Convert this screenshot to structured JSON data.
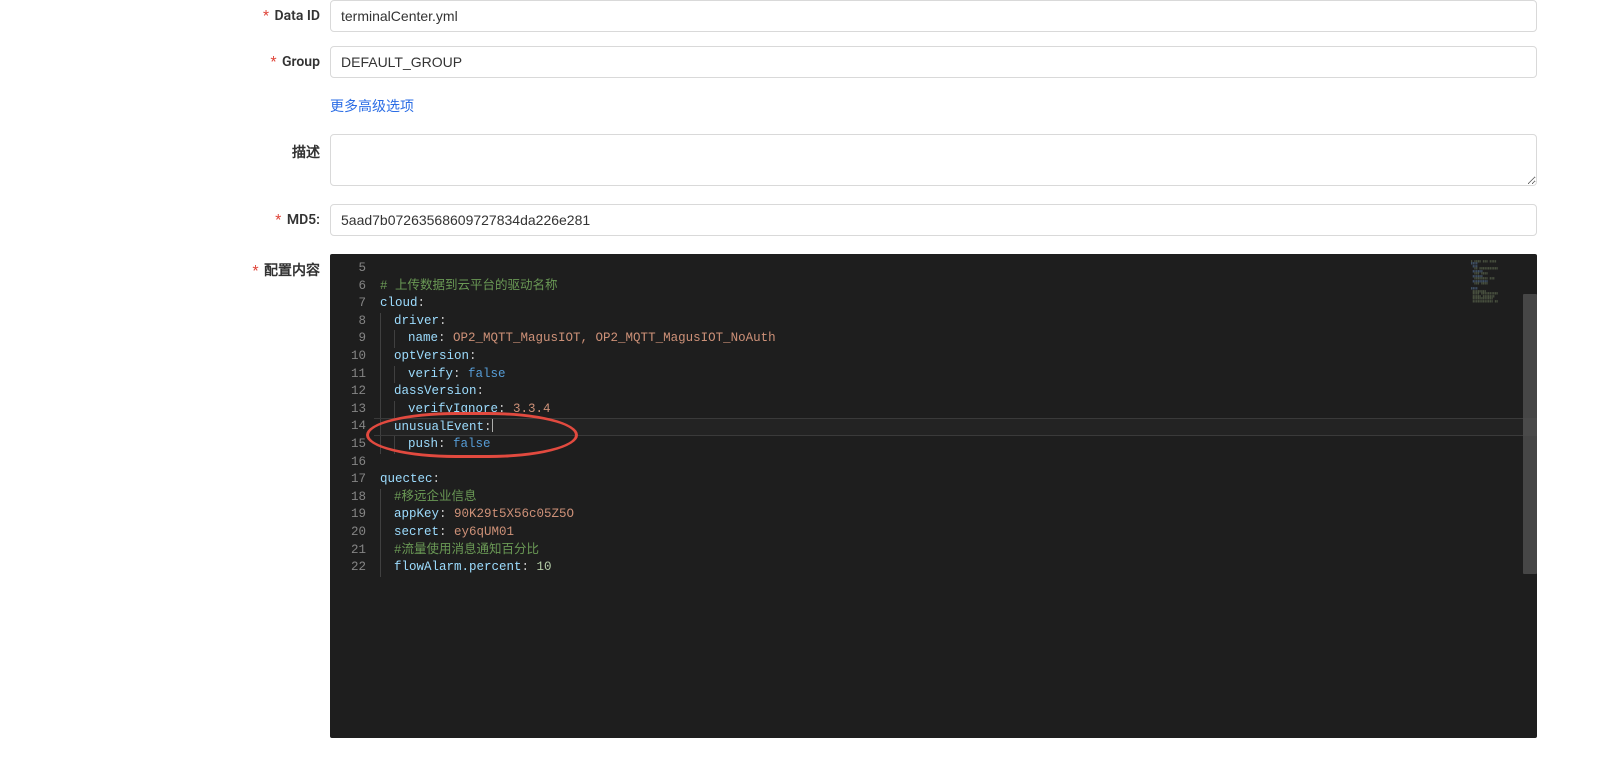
{
  "form": {
    "dataId": {
      "label": "Data ID",
      "value": "terminalCenter.yml"
    },
    "group": {
      "label": "Group",
      "value": "DEFAULT_GROUP"
    },
    "advancedLink": "更多高级选项",
    "description": {
      "label": "描述",
      "value": ""
    },
    "md5": {
      "label": "MD5:",
      "value": "5aad7b07263568609727834da226e281"
    },
    "configContent": {
      "label": "配置内容"
    }
  },
  "editor": {
    "startLine": 5,
    "activeLine": 14,
    "lines": [
      {
        "n": 5,
        "indent": 0,
        "segs": []
      },
      {
        "n": 6,
        "indent": 0,
        "segs": [
          {
            "t": "comment",
            "v": "# 上传数据到云平台的驱动名称"
          }
        ]
      },
      {
        "n": 7,
        "indent": 0,
        "segs": [
          {
            "t": "key",
            "v": "cloud"
          },
          {
            "t": "colon",
            "v": ":"
          }
        ]
      },
      {
        "n": 8,
        "indent": 1,
        "segs": [
          {
            "t": "key",
            "v": "driver"
          },
          {
            "t": "colon",
            "v": ":"
          }
        ]
      },
      {
        "n": 9,
        "indent": 2,
        "segs": [
          {
            "t": "key",
            "v": "name"
          },
          {
            "t": "colon",
            "v": ": "
          },
          {
            "t": "string",
            "v": "OP2_MQTT_MagusIOT, OP2_MQTT_MagusIOT_NoAuth"
          }
        ]
      },
      {
        "n": 10,
        "indent": 1,
        "segs": [
          {
            "t": "key",
            "v": "optVersion"
          },
          {
            "t": "colon",
            "v": ":"
          }
        ]
      },
      {
        "n": 11,
        "indent": 2,
        "segs": [
          {
            "t": "key",
            "v": "verify"
          },
          {
            "t": "colon",
            "v": ": "
          },
          {
            "t": "bool",
            "v": "false"
          }
        ]
      },
      {
        "n": 12,
        "indent": 1,
        "segs": [
          {
            "t": "key",
            "v": "dassVersion"
          },
          {
            "t": "colon",
            "v": ":"
          }
        ]
      },
      {
        "n": 13,
        "indent": 2,
        "segs": [
          {
            "t": "key",
            "v": "verifyIgnore"
          },
          {
            "t": "colon",
            "v": ": "
          },
          {
            "t": "string",
            "v": "3.3.4"
          }
        ]
      },
      {
        "n": 14,
        "indent": 1,
        "segs": [
          {
            "t": "key",
            "v": "unusualEvent"
          },
          {
            "t": "colon",
            "v": ":"
          }
        ],
        "active": true,
        "caret": true
      },
      {
        "n": 15,
        "indent": 2,
        "segs": [
          {
            "t": "key",
            "v": "push"
          },
          {
            "t": "colon",
            "v": ": "
          },
          {
            "t": "bool",
            "v": "false"
          }
        ]
      },
      {
        "n": 16,
        "indent": 0,
        "segs": []
      },
      {
        "n": 17,
        "indent": 0,
        "segs": [
          {
            "t": "key",
            "v": "quectec"
          },
          {
            "t": "colon",
            "v": ":"
          }
        ]
      },
      {
        "n": 18,
        "indent": 1,
        "segs": [
          {
            "t": "comment",
            "v": "#移远企业信息"
          }
        ]
      },
      {
        "n": 19,
        "indent": 1,
        "segs": [
          {
            "t": "key",
            "v": "appKey"
          },
          {
            "t": "colon",
            "v": ": "
          },
          {
            "t": "string",
            "v": "90K29t5X56c05Z5O"
          }
        ]
      },
      {
        "n": 20,
        "indent": 1,
        "segs": [
          {
            "t": "key",
            "v": "secret"
          },
          {
            "t": "colon",
            "v": ": "
          },
          {
            "t": "string",
            "v": "ey6qUM01"
          }
        ]
      },
      {
        "n": 21,
        "indent": 1,
        "segs": [
          {
            "t": "comment",
            "v": "#流量使用消息通知百分比"
          }
        ]
      },
      {
        "n": 22,
        "indent": 1,
        "segs": [
          {
            "t": "key",
            "v": "flowAlarm.percent"
          },
          {
            "t": "colon",
            "v": ": "
          },
          {
            "t": "number",
            "v": "10"
          }
        ]
      }
    ]
  },
  "annotation": {
    "redEllipse": {
      "targetLines": [
        14,
        15
      ]
    }
  }
}
